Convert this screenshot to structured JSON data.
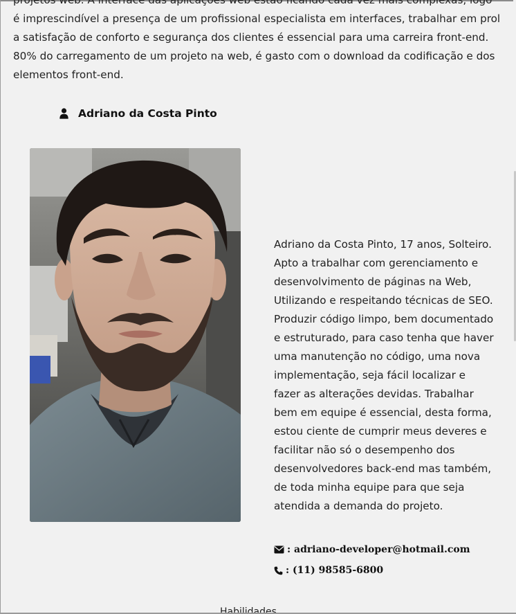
{
  "intro": {
    "text": "projetos web. A interface das aplicações web estão ficando cada vez mais complexas, logo é imprescindível a presença de um profissional especialista em interfaces, trabalhar em prol a satisfação de conforto e segurança dos clientes é essencial para uma carreira front-end. 80% do carregamento de um projeto na web, é gasto com o download da codificação e dos elementos front-end."
  },
  "author": {
    "icon": "user-icon",
    "name": "Adriano da Costa Pinto"
  },
  "photo": {
    "description_icon": "profile-photo"
  },
  "bio": {
    "text": "Adriano da Costa Pinto, 17 anos, Solteiro. Apto a trabalhar com gerenciamento e desenvolvimento de páginas na Web, Utilizando e respeitando técnicas de SEO. Produzir código limpo, bem documentado e estruturado, para caso tenha que haver uma manutenção no código, uma nova implementação, seja fácil localizar e fazer as alterações devidas. Trabalhar bem em equipe é essencial, desta forma, estou ciente de cumprir meus deveres e facilitar não só o desempenho dos desenvolvedores back-end mas também, de toda minha equipe para que seja atendida a demanda do projeto."
  },
  "contacts": {
    "email": {
      "icon": "envelope-icon",
      "text": ": adriano-developer@hotmail.com"
    },
    "phone": {
      "icon": "phone-icon",
      "text": ": (11) 98585-6800"
    }
  },
  "next_section": {
    "heading": "Habilidades"
  },
  "colors": {
    "background": "#f1f1f1",
    "text": "#222222"
  }
}
